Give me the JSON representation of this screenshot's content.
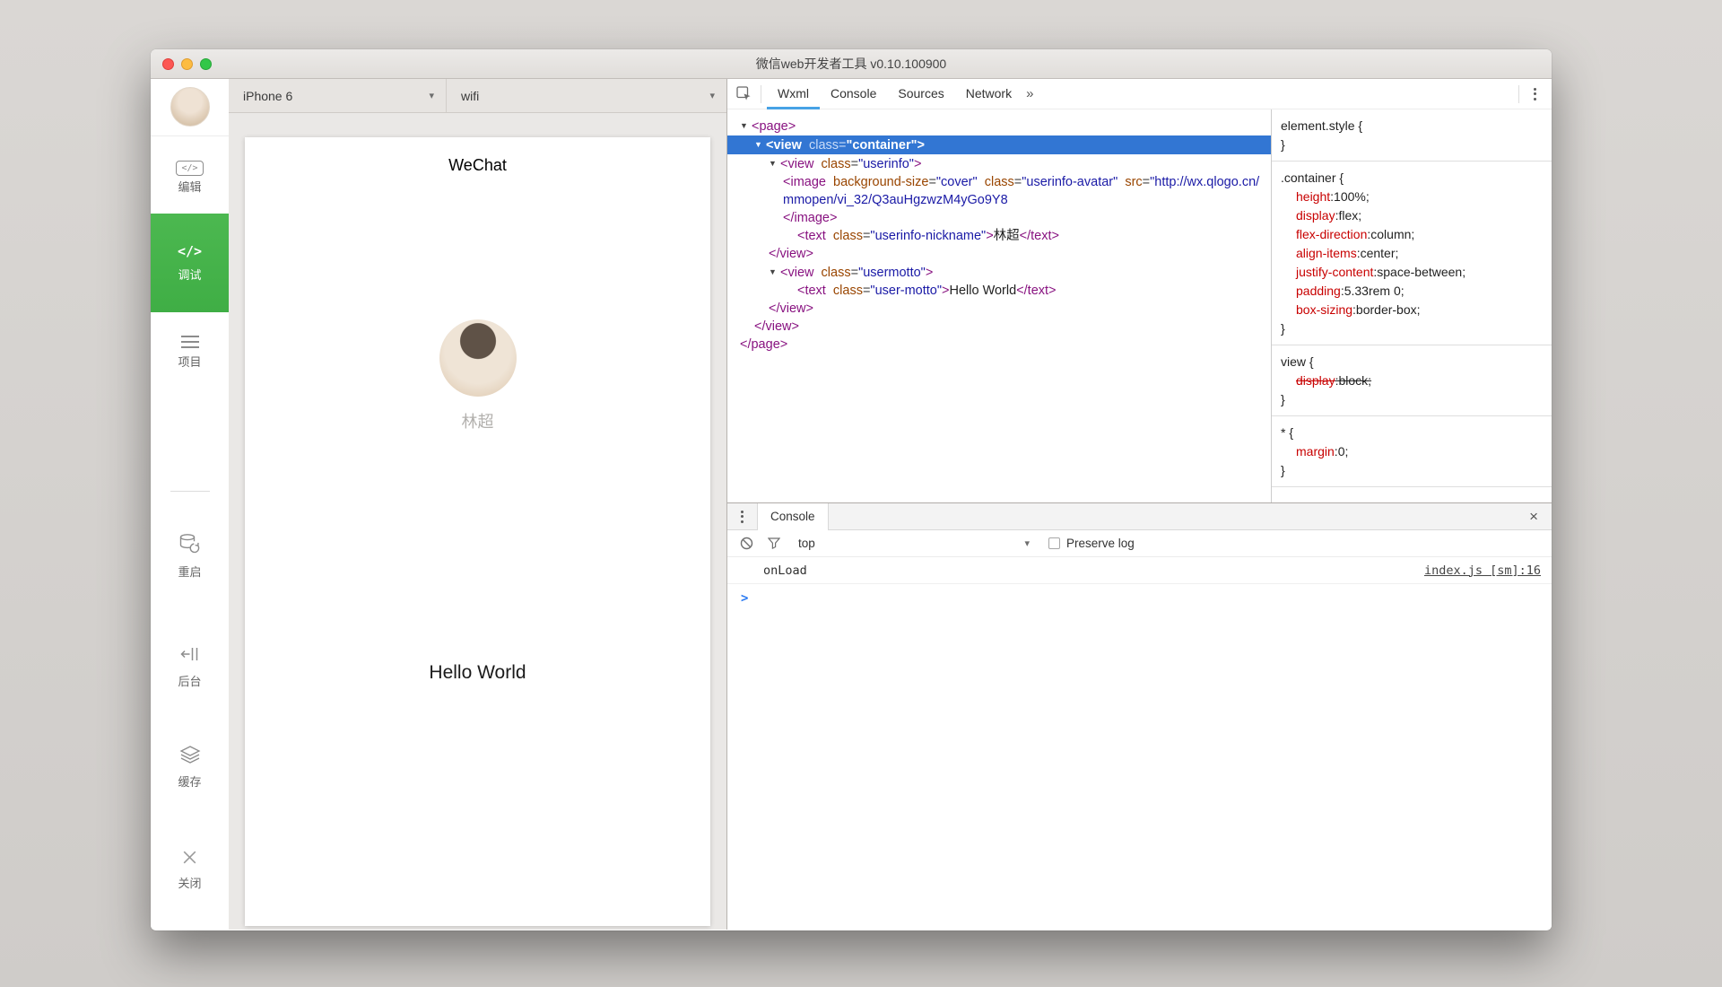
{
  "window": {
    "title": "微信web开发者工具 v0.10.100900"
  },
  "sidebar": {
    "items": [
      {
        "id": "edit",
        "label": "编辑",
        "icon": "code-box-icon",
        "active": false
      },
      {
        "id": "debug",
        "label": "调试",
        "icon": "code-icon",
        "active": true
      },
      {
        "id": "project",
        "label": "项目",
        "icon": "menu-icon",
        "active": false
      },
      {
        "id": "restart",
        "label": "重启",
        "icon": "db-refresh-icon",
        "active": false,
        "group": 2
      },
      {
        "id": "background",
        "label": "后台",
        "icon": "to-back-icon",
        "active": false,
        "group": 2
      },
      {
        "id": "cache",
        "label": "缓存",
        "icon": "layers-icon",
        "active": false,
        "group": 2
      },
      {
        "id": "close",
        "label": "关闭",
        "icon": "close-icon",
        "active": false,
        "group": 2
      }
    ]
  },
  "toolbar": {
    "device": "iPhone 6",
    "network": "wifi"
  },
  "phone": {
    "navbar_title": "WeChat",
    "nickname": "林超",
    "motto": "Hello World"
  },
  "devtools": {
    "tabs": [
      {
        "label": "Wxml",
        "active": true
      },
      {
        "label": "Console",
        "active": false
      },
      {
        "label": "Sources",
        "active": false
      },
      {
        "label": "Network",
        "active": false
      }
    ],
    "overflow_label": "»",
    "tree": {
      "lines": [
        {
          "indent": 0,
          "arrow": true,
          "selected": false,
          "tokens": [
            [
              "tag",
              "<page>"
            ]
          ]
        },
        {
          "indent": 1,
          "arrow": true,
          "selected": true,
          "tokens": [
            [
              "tag",
              "<view"
            ],
            [
              "eq",
              "  "
            ],
            [
              "attr",
              "class"
            ],
            [
              "eq",
              "="
            ],
            [
              "val",
              "\"container\""
            ],
            [
              "tag",
              ">"
            ]
          ]
        },
        {
          "indent": 2,
          "arrow": true,
          "selected": false,
          "tokens": [
            [
              "tag",
              "<view"
            ],
            [
              "eq",
              "  "
            ],
            [
              "attr",
              "class"
            ],
            [
              "eq",
              "="
            ],
            [
              "val",
              "\"userinfo\""
            ],
            [
              "tag",
              ">"
            ]
          ]
        },
        {
          "indent": 3,
          "arrow": false,
          "selected": false,
          "tokens": [
            [
              "tag",
              "<image"
            ],
            [
              "eq",
              "  "
            ],
            [
              "attr",
              "background-size"
            ],
            [
              "eq",
              "="
            ],
            [
              "val",
              "\"cover\""
            ],
            [
              "eq",
              "  "
            ],
            [
              "attr",
              "class"
            ],
            [
              "eq",
              "="
            ],
            [
              "val",
              "\"userinfo-avatar\""
            ],
            [
              "eq",
              "  "
            ],
            [
              "attr",
              "src"
            ],
            [
              "eq",
              "="
            ],
            [
              "val",
              "\"http://wx.qlogo.cn/mmopen/vi_32/Q3auHgzwzM4yGo9Y8"
            ]
          ]
        },
        {
          "indent": 3,
          "arrow": false,
          "selected": false,
          "tokens": [
            [
              "tag",
              "</image>"
            ]
          ]
        },
        {
          "indent": 4,
          "arrow": false,
          "selected": false,
          "tokens": [
            [
              "tag",
              "<text"
            ],
            [
              "eq",
              "  "
            ],
            [
              "attr",
              "class"
            ],
            [
              "eq",
              "="
            ],
            [
              "val",
              "\"userinfo-nickname\""
            ],
            [
              "tag",
              ">"
            ],
            [
              "txt",
              "林超"
            ],
            [
              "tag",
              "</text>"
            ]
          ]
        },
        {
          "indent": 2,
          "arrow": false,
          "selected": false,
          "tokens": [
            [
              "tag",
              "</view>"
            ]
          ]
        },
        {
          "indent": 2,
          "arrow": true,
          "selected": false,
          "tokens": [
            [
              "tag",
              "<view"
            ],
            [
              "eq",
              "  "
            ],
            [
              "attr",
              "class"
            ],
            [
              "eq",
              "="
            ],
            [
              "val",
              "\"usermotto\""
            ],
            [
              "tag",
              ">"
            ]
          ]
        },
        {
          "indent": 4,
          "arrow": false,
          "selected": false,
          "tokens": [
            [
              "tag",
              "<text"
            ],
            [
              "eq",
              "  "
            ],
            [
              "attr",
              "class"
            ],
            [
              "eq",
              "="
            ],
            [
              "val",
              "\"user-motto\""
            ],
            [
              "tag",
              ">"
            ],
            [
              "txt",
              "Hello World"
            ],
            [
              "tag",
              "</text>"
            ]
          ]
        },
        {
          "indent": 2,
          "arrow": false,
          "selected": false,
          "tokens": [
            [
              "tag",
              "</view>"
            ]
          ]
        },
        {
          "indent": 1,
          "arrow": false,
          "selected": false,
          "tokens": [
            [
              "tag",
              "</view>"
            ]
          ]
        },
        {
          "indent": 0,
          "arrow": false,
          "selected": false,
          "tokens": [
            [
              "tag",
              "</page>"
            ]
          ]
        }
      ]
    },
    "styles": {
      "sections": [
        {
          "selector": "element.style",
          "props": []
        },
        {
          "selector": ".container",
          "props": [
            {
              "name": "height",
              "value": "100%"
            },
            {
              "name": "display",
              "value": "flex"
            },
            {
              "name": "flex-direction",
              "value": "column"
            },
            {
              "name": "align-items",
              "value": "center"
            },
            {
              "name": "justify-content",
              "value": "space-between"
            },
            {
              "name": "padding",
              "value": "5.33rem 0"
            },
            {
              "name": "box-sizing",
              "value": "border-box"
            }
          ]
        },
        {
          "selector": "view",
          "props": [
            {
              "name": "display",
              "value": "block",
              "struck": true
            }
          ]
        },
        {
          "selector": "*",
          "props": [
            {
              "name": "margin",
              "value": "0"
            }
          ]
        }
      ]
    }
  },
  "console": {
    "tab_label": "Console",
    "filter_scope": "top",
    "preserve_log_label": "Preserve log",
    "preserve_log_checked": false,
    "entries": [
      {
        "message": "onLoad",
        "source": "index.js [sm]:16"
      }
    ],
    "prompt": ">"
  },
  "colors": {
    "accent_green": "#44b549",
    "selection_blue": "#3276d3",
    "tab_underline_blue": "#47a2e5",
    "tag_purple": "#881280",
    "attr_orange": "#994500",
    "value_blue": "#1a1aa6",
    "property_red": "#c80000",
    "prompt_blue": "#2a7af2"
  }
}
